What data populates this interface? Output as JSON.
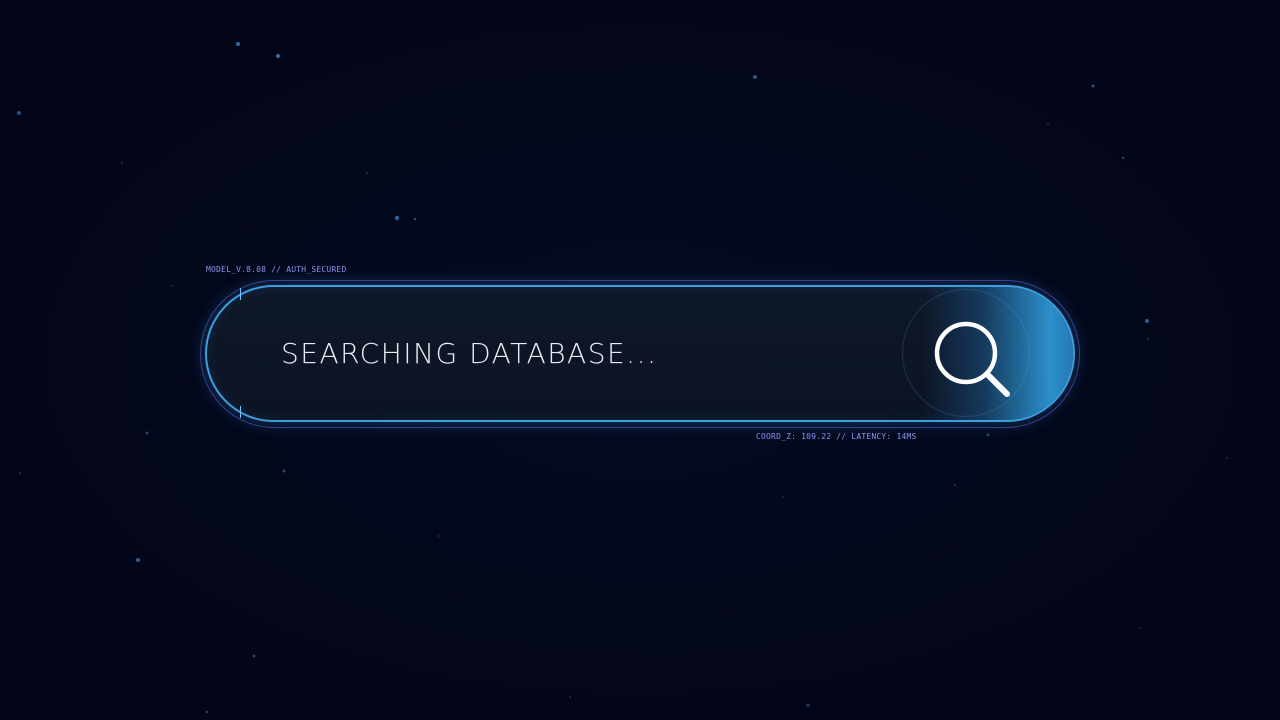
{
  "meta": {
    "top_label": "MODEL_V.8.08 // AUTH_SECURED",
    "bottom_label": "COORD_Z: 109.22 // LATENCY: 14MS"
  },
  "search": {
    "status_text": "SEARCHING DATABASE...",
    "button_icon": "search-icon"
  },
  "colors": {
    "background": "#030719",
    "accent": "#3e9fdf",
    "meta_text": "#8a93ee",
    "primary_text": "#e9eef6"
  }
}
